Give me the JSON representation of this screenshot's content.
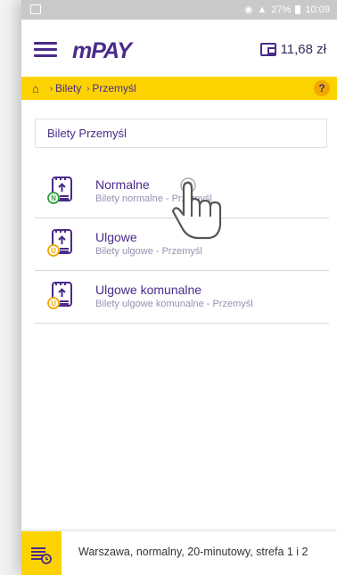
{
  "status_bar": {
    "battery": "27%",
    "time": "10:09"
  },
  "app": {
    "logo": "mPAY",
    "balance": "11,68 zł"
  },
  "breadcrumb": {
    "items": [
      "Bilety",
      "Przemyśl"
    ],
    "help": "?"
  },
  "search": {
    "value": "Bilety Przemyśl"
  },
  "tickets": [
    {
      "title": "Normalne",
      "subtitle": "Bilety normalne - Przemyśl",
      "badge": "N",
      "badge_color": "#2e9e3a"
    },
    {
      "title": "Ulgowe",
      "subtitle": "Bilety ulgowe - Przemyśl",
      "badge": "U",
      "badge_color": "#f0a800"
    },
    {
      "title": "Ulgowe komunalne",
      "subtitle": "Bilety ulgowe komunalne - Przemyśl",
      "badge": "U",
      "badge_color": "#f0a800"
    }
  ],
  "bottom_bar": {
    "text": "Warszawa, normalny, 20-minutowy, strefa 1 i 2"
  },
  "colors": {
    "brand": "#4a2a8a",
    "accent": "#fcd200"
  }
}
